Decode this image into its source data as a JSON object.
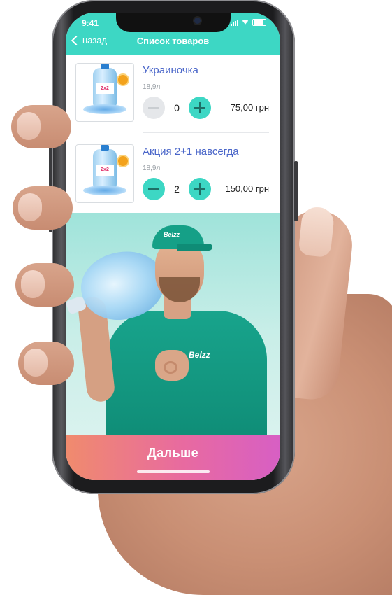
{
  "status_bar": {
    "time": "9:41"
  },
  "header": {
    "back_label": "назад",
    "title": "Список товаров"
  },
  "products": [
    {
      "name": "Украиночка",
      "volume": "18,9л",
      "quantity": "0",
      "price": "75,00 грн",
      "minus_enabled": false
    },
    {
      "name": "Акция 2+1 навсегда",
      "volume": "18,9л",
      "quantity": "2",
      "price": "150,00 грн",
      "minus_enabled": true
    }
  ],
  "product_image_label": "2x2",
  "promo": {
    "cap_logo": "Belzz",
    "shirt_logo": "Belzz"
  },
  "cta": {
    "label": "Дальше"
  },
  "colors": {
    "accent": "#3dd7c4",
    "title_link": "#4a66c9",
    "cta_start": "#f08b6d",
    "cta_end": "#d75fc4"
  }
}
